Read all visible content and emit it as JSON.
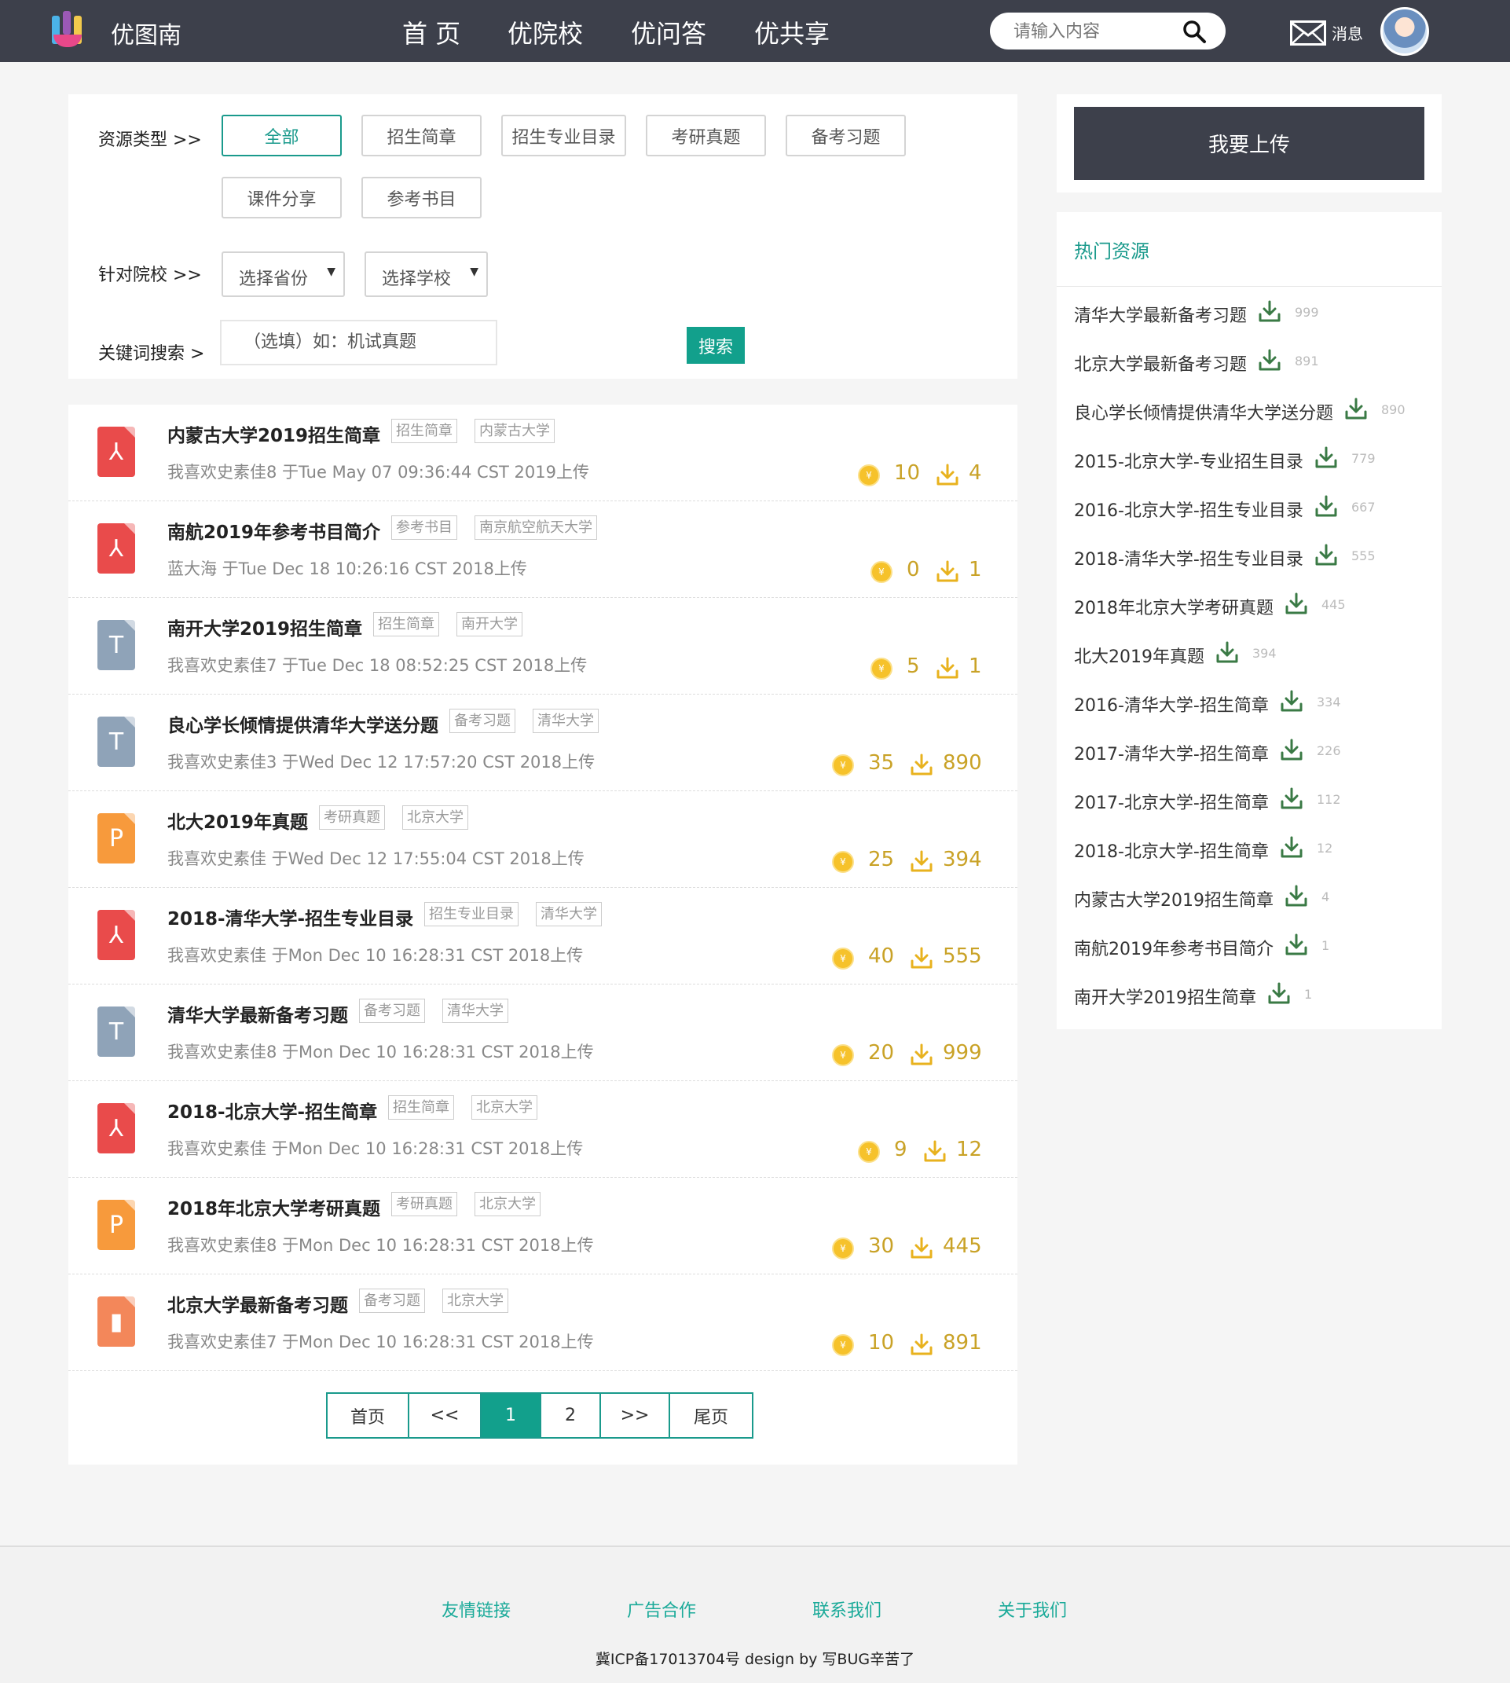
{
  "nav": {
    "brand": "优图南",
    "menu": [
      "首 页",
      "优院校",
      "优问答",
      "优共享"
    ],
    "search_placeholder": "请输入内容",
    "message_label": "消息"
  },
  "filter": {
    "type_label": "资源类型 >>",
    "types": [
      "全部",
      "招生简章",
      "招生专业目录",
      "考研真题",
      "备考习题",
      "课件分享",
      "参考书目"
    ],
    "school_label": "针对院校 >>",
    "province_select": "选择省份",
    "school_select": "选择学校",
    "keyword_label": "关键词搜索 >",
    "keyword_placeholder": "（选填）如：机试真题",
    "search_button": "搜索"
  },
  "list": [
    {
      "icon": "pdf-icon",
      "title": "内蒙古大学2019招生简章",
      "tags": [
        "招生简章",
        "内蒙古大学"
      ],
      "meta": "我喜欢史素佳8 于Tue May 07 09:36:44 CST 2019上传",
      "coins": "10",
      "downloads": "4"
    },
    {
      "icon": "pdf-icon",
      "title": "南航2019年参考书目简介",
      "tags": [
        "参考书目",
        "南京航空航天大学"
      ],
      "meta": "蓝大海 于Tue Dec 18 10:26:16 CST 2018上传",
      "coins": "0",
      "downloads": "1"
    },
    {
      "icon": "txt-icon",
      "title": "南开大学2019招生简章",
      "tags": [
        "招生简章",
        "南开大学"
      ],
      "meta": "我喜欢史素佳7 于Tue Dec 18 08:52:25 CST 2018上传",
      "coins": "5",
      "downloads": "1"
    },
    {
      "icon": "txt-icon",
      "title": "良心学长倾情提供清华大学送分题",
      "tags": [
        "备考习题",
        "清华大学"
      ],
      "meta": "我喜欢史素佳3 于Wed Dec 12 17:57:20 CST 2018上传",
      "coins": "35",
      "downloads": "890"
    },
    {
      "icon": "ppt-icon",
      "title": "北大2019年真题",
      "tags": [
        "考研真题",
        "北京大学"
      ],
      "meta": "我喜欢史素佳 于Wed Dec 12 17:55:04 CST 2018上传",
      "coins": "25",
      "downloads": "394"
    },
    {
      "icon": "pdf-icon",
      "title": "2018-清华大学-招生专业目录",
      "tags": [
        "招生专业目录",
        "清华大学"
      ],
      "meta": "我喜欢史素佳 于Mon Dec 10 16:28:31 CST 2018上传",
      "coins": "40",
      "downloads": "555"
    },
    {
      "icon": "txt-icon",
      "title": "清华大学最新备考习题",
      "tags": [
        "备考习题",
        "清华大学"
      ],
      "meta": "我喜欢史素佳8 于Mon Dec 10 16:28:31 CST 2018上传",
      "coins": "20",
      "downloads": "999"
    },
    {
      "icon": "pdf-icon",
      "title": "2018-北京大学-招生简章",
      "tags": [
        "招生简章",
        "北京大学"
      ],
      "meta": "我喜欢史素佳 于Mon Dec 10 16:28:31 CST 2018上传",
      "coins": "9",
      "downloads": "12"
    },
    {
      "icon": "ppt-icon",
      "title": "2018年北京大学考研真题",
      "tags": [
        "考研真题",
        "北京大学"
      ],
      "meta": "我喜欢史素佳8 于Mon Dec 10 16:28:31 CST 2018上传",
      "coins": "30",
      "downloads": "445"
    },
    {
      "icon": "zip-icon",
      "title": "北京大学最新备考习题",
      "tags": [
        "备考习题",
        "北京大学"
      ],
      "meta": "我喜欢史素佳7 于Mon Dec 10 16:28:31 CST 2018上传",
      "coins": "10",
      "downloads": "891"
    }
  ],
  "pager": [
    "首页",
    "<<",
    "1",
    "2",
    ">>",
    "尾页"
  ],
  "sidebar": {
    "upload_button": "我要上传",
    "hot_title": "热门资源",
    "hot": [
      {
        "title": "清华大学最新备考习题",
        "count": "999"
      },
      {
        "title": "北京大学最新备考习题",
        "count": "891"
      },
      {
        "title": "良心学长倾情提供清华大学送分题",
        "count": "890"
      },
      {
        "title": "2015-北京大学-专业招生目录",
        "count": "779"
      },
      {
        "title": "2016-北京大学-招生专业目录",
        "count": "667"
      },
      {
        "title": "2018-清华大学-招生专业目录",
        "count": "555"
      },
      {
        "title": "2018年北京大学考研真题",
        "count": "445"
      },
      {
        "title": "北大2019年真题",
        "count": "394"
      },
      {
        "title": "2016-清华大学-招生简章",
        "count": "334"
      },
      {
        "title": "2017-清华大学-招生简章",
        "count": "226"
      },
      {
        "title": "2017-北京大学-招生简章",
        "count": "112"
      },
      {
        "title": "2018-北京大学-招生简章",
        "count": "12"
      },
      {
        "title": "内蒙古大学2019招生简章",
        "count": "4"
      },
      {
        "title": "南航2019年参考书目简介",
        "count": "1"
      },
      {
        "title": "南开大学2019招生简章",
        "count": "1"
      }
    ]
  },
  "footer": {
    "links": [
      "友情链接",
      "广告合作",
      "联系我们",
      "关于我们"
    ],
    "copyright": "冀ICP备17013704号 design by 写BUG辛苦了"
  },
  "colors": {
    "accent": "#12a08c",
    "nav": "#3d404b",
    "coin": "#f6c22b"
  }
}
